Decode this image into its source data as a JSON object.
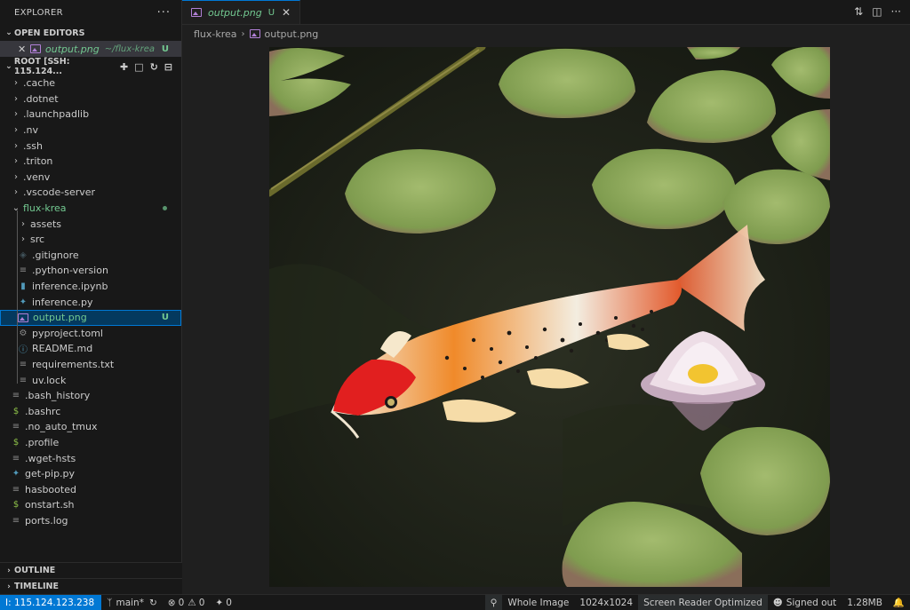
{
  "sidebar": {
    "title": "EXPLORER",
    "more": "···",
    "open_editors": {
      "title": "OPEN EDITORS",
      "item": {
        "name": "output.png",
        "path": "~/flux-krea",
        "badge": "U"
      }
    },
    "root": {
      "label": "ROOT [SSH: 115.124..."
    },
    "tree": [
      {
        "label": ".cache",
        "kind": "folder"
      },
      {
        "label": ".dotnet",
        "kind": "folder"
      },
      {
        "label": ".launchpadlib",
        "kind": "folder"
      },
      {
        "label": ".nv",
        "kind": "folder"
      },
      {
        "label": ".ssh",
        "kind": "folder"
      },
      {
        "label": ".triton",
        "kind": "folder"
      },
      {
        "label": ".venv",
        "kind": "folder"
      },
      {
        "label": ".vscode-server",
        "kind": "folder"
      },
      {
        "label": "flux-krea",
        "kind": "folder-open"
      },
      {
        "label": "assets",
        "kind": "folder"
      },
      {
        "label": "src",
        "kind": "folder"
      },
      {
        "label": ".gitignore",
        "kind": "file"
      },
      {
        "label": ".python-version",
        "kind": "file"
      },
      {
        "label": "inference.ipynb",
        "kind": "file"
      },
      {
        "label": "inference.py",
        "kind": "file"
      },
      {
        "label": "output.png",
        "kind": "file",
        "badge": "U"
      },
      {
        "label": "pyproject.toml",
        "kind": "file"
      },
      {
        "label": "README.md",
        "kind": "file"
      },
      {
        "label": "requirements.txt",
        "kind": "file"
      },
      {
        "label": "uv.lock",
        "kind": "file"
      },
      {
        "label": ".bash_history",
        "kind": "file"
      },
      {
        "label": ".bashrc",
        "kind": "file"
      },
      {
        "label": ".no_auto_tmux",
        "kind": "file"
      },
      {
        "label": ".profile",
        "kind": "file"
      },
      {
        "label": ".wget-hsts",
        "kind": "file"
      },
      {
        "label": "get-pip.py",
        "kind": "file"
      },
      {
        "label": "hasbooted",
        "kind": "file"
      },
      {
        "label": "onstart.sh",
        "kind": "file"
      },
      {
        "label": "ports.log",
        "kind": "file"
      }
    ],
    "outline": "OUTLINE",
    "timeline": "TIMELINE"
  },
  "editor": {
    "tab": {
      "name": "output.png",
      "badge": "U"
    },
    "breadcrumb": {
      "folder": "flux-krea",
      "file": "output.png"
    }
  },
  "statusbar": {
    "remote": "I: 115.124.123.238",
    "branch": "main*",
    "errors": "0",
    "warnings": "0",
    "ports": "0",
    "zoom_mode": "Whole Image",
    "dimensions": "1024x1024",
    "screen_reader": "Screen Reader Optimized",
    "account": "Signed out",
    "file_size": "1.28MB"
  },
  "colors": {
    "accent": "#0078d4",
    "git_untracked": "#73c991",
    "image_icon": "#b180d7"
  }
}
